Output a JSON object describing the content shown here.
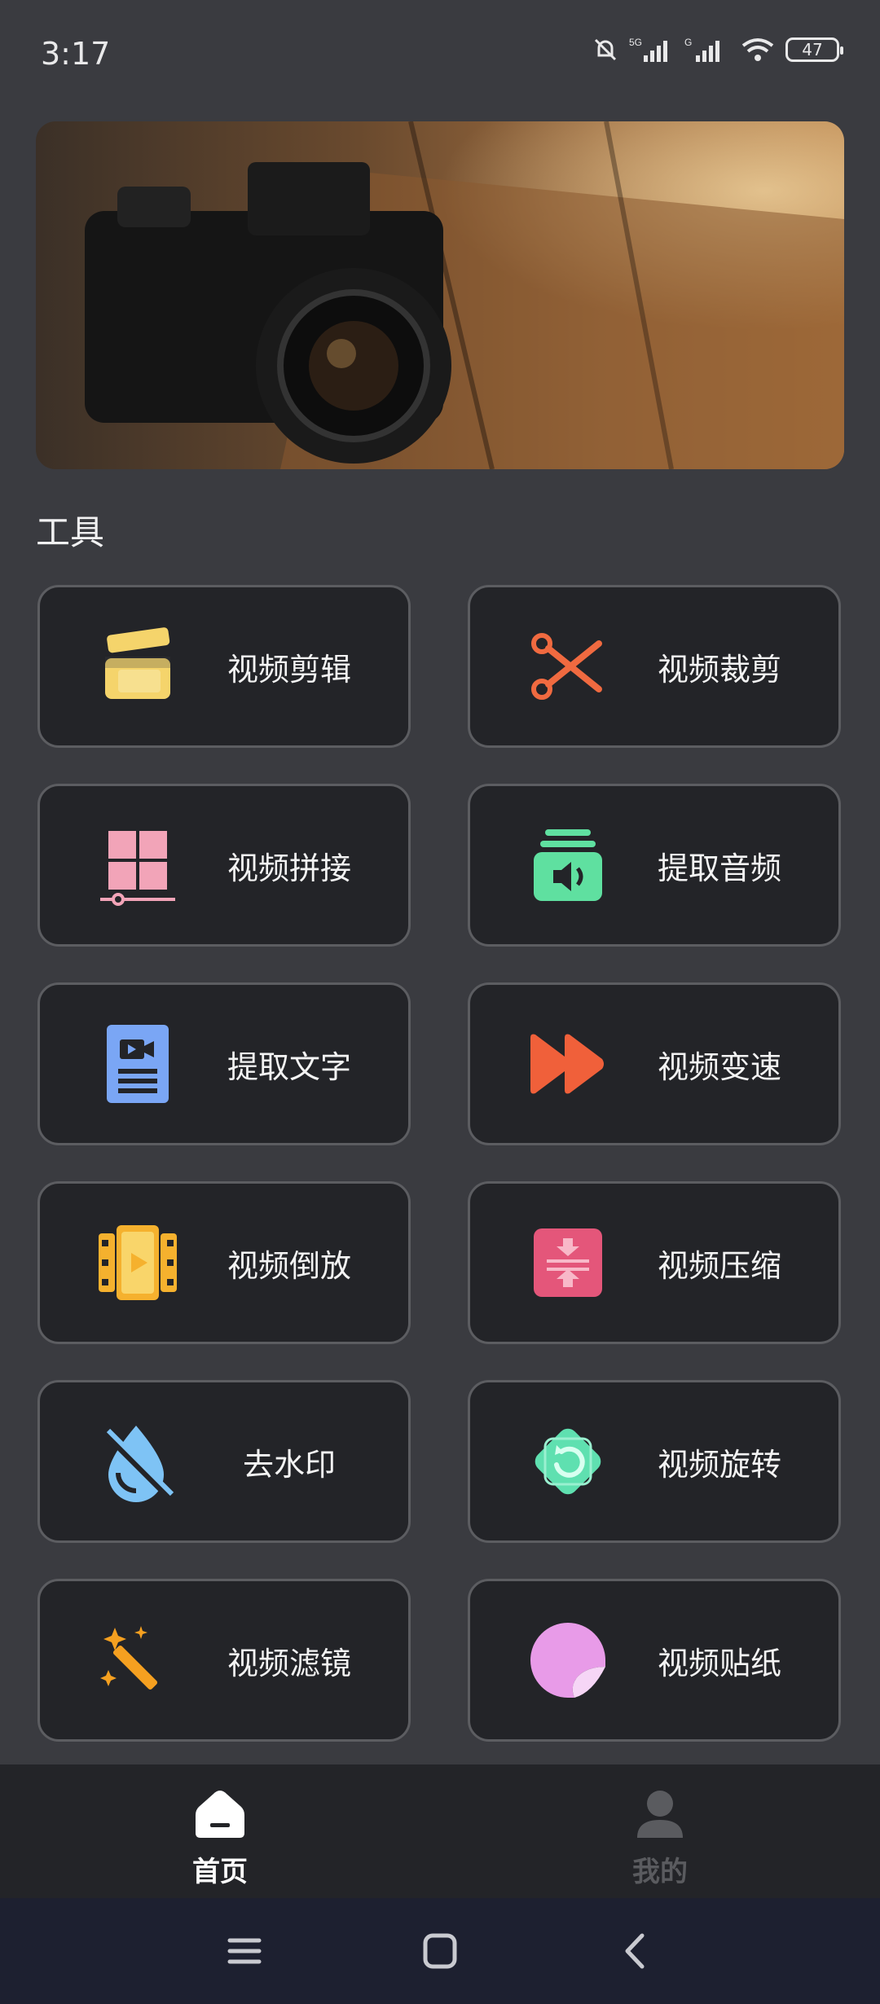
{
  "status": {
    "time": "3:17",
    "battery": "47"
  },
  "section_title": "工具",
  "tools": [
    {
      "label": "视频剪辑",
      "icon": "clapperboard-icon"
    },
    {
      "label": "视频裁剪",
      "icon": "scissors-icon"
    },
    {
      "label": "视频拼接",
      "icon": "merge-grid-icon"
    },
    {
      "label": "提取音频",
      "icon": "audio-extract-icon"
    },
    {
      "label": "提取文字",
      "icon": "text-document-icon"
    },
    {
      "label": "视频变速",
      "icon": "fast-forward-icon"
    },
    {
      "label": "视频倒放",
      "icon": "reverse-play-icon"
    },
    {
      "label": "视频压缩",
      "icon": "compress-icon"
    },
    {
      "label": "去水印",
      "icon": "watermark-remove-icon"
    },
    {
      "label": "视频旋转",
      "icon": "rotate-icon"
    },
    {
      "label": "视频滤镜",
      "icon": "magic-wand-icon"
    },
    {
      "label": "视频贴纸",
      "icon": "sticker-icon"
    }
  ],
  "bottom_nav": {
    "home": "首页",
    "mine": "我的"
  },
  "colors": {
    "background": "#3a3b40",
    "card": "#232428",
    "card_border": "#5c5d61",
    "nav_active": "#ffffff",
    "nav_inactive": "#5a5b5f"
  }
}
